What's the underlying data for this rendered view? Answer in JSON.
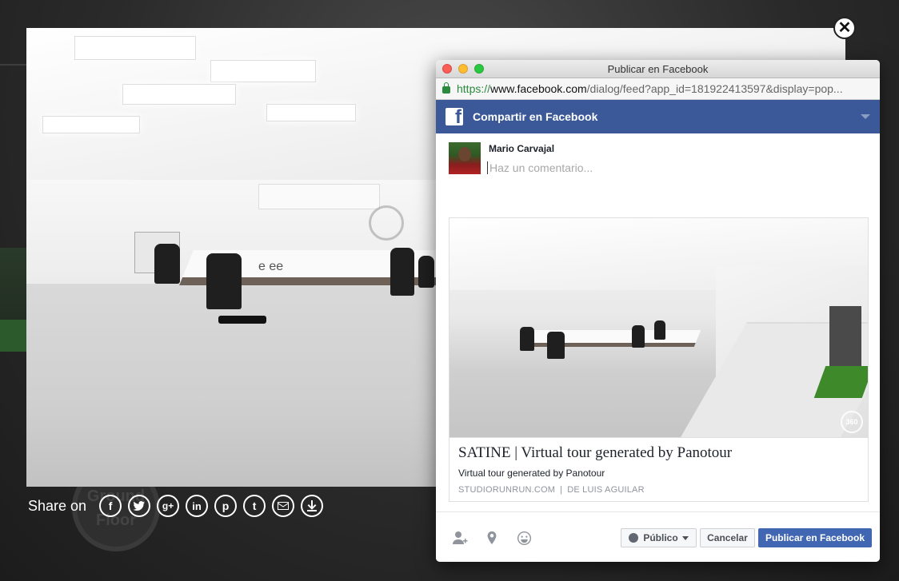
{
  "share": {
    "label": "Share on",
    "icons": [
      "facebook-icon",
      "twitter-icon",
      "google-plus-icon",
      "linkedin-icon",
      "pinterest-icon",
      "tumblr-icon",
      "mail-icon",
      "download-icon"
    ]
  },
  "viewer": {
    "close_icon": "close-icon",
    "floor_logo_text": "Ground Floor"
  },
  "popup": {
    "window_title": "Publicar en Facebook",
    "url": {
      "scheme": "https://",
      "host": "www.facebook.com",
      "rest": "/dialog/feed?app_id=181922413597&display=pop..."
    },
    "header": {
      "logo": "f",
      "title": "Compartir en Facebook"
    },
    "composer": {
      "user_name": "Mario Carvajal",
      "placeholder": "Haz un comentario..."
    },
    "preview": {
      "title": "SATINE | Virtual tour generated by Panotour",
      "description": "Virtual tour generated by Panotour",
      "source_domain": "STUDIORUNRUN.COM",
      "separator": "|",
      "source_author": "DE LUIS AGUILAR",
      "badge": "360"
    },
    "footer": {
      "audience_label": "Público",
      "cancel_label": "Cancelar",
      "publish_label": "Publicar en Facebook"
    }
  },
  "colors": {
    "facebook_blue": "#3b5998",
    "publish_button": "#4267b2",
    "url_green": "#2b8a3e"
  }
}
